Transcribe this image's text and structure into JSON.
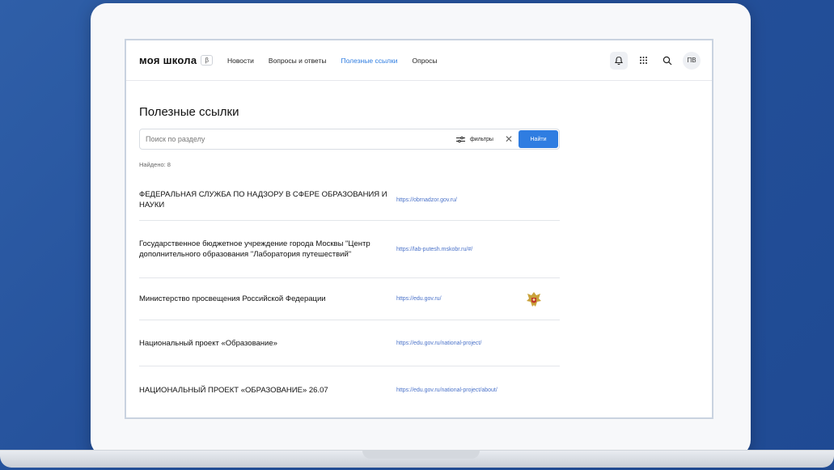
{
  "header": {
    "logo": "моя школа",
    "beta": "β",
    "nav": [
      "Новости",
      "Вопросы и ответы",
      "Полезные ссылки",
      "Опросы"
    ],
    "avatar": "ПВ"
  },
  "page": {
    "title": "Полезные ссылки",
    "search_placeholder": "Поиск по разделу",
    "filter_label": "фильтры",
    "find_label": "Найти",
    "found_text": "Найдено: 8"
  },
  "links": [
    {
      "title": "ФЕДЕРАЛЬНАЯ СЛУЖБА ПО НАДЗОРУ В СФЕРЕ ОБРАЗОВАНИЯ И НАУКИ",
      "url": "https://obrnadzor.gov.ru/"
    },
    {
      "title": "Государственное бюджетное учреждение города Москвы \"Центр дополнительного образования \"Лаборатория путешествий\"",
      "url": "https://lab-putesh.mskobr.ru/#/"
    },
    {
      "title": "Министерство просвещения Российской Федерации",
      "url": "https://edu.gov.ru/"
    },
    {
      "title": "Национальный проект «Образование»",
      "url": "https://edu.gov.ru/national-project/"
    },
    {
      "title": "НАЦИОНАЛЬНЫЙ ПРОЕКТ «ОБРАЗОВАНИЕ» 26.07",
      "url": "https://edu.gov.ru/national-project/about/"
    }
  ],
  "colors": {
    "accent": "#2f7de1",
    "link": "#4a72c9",
    "background": "#2a579e"
  },
  "icons": [
    "bell-icon",
    "apps-grid-icon",
    "search-icon",
    "filter-icon",
    "close-icon",
    "emblem-icon"
  ]
}
